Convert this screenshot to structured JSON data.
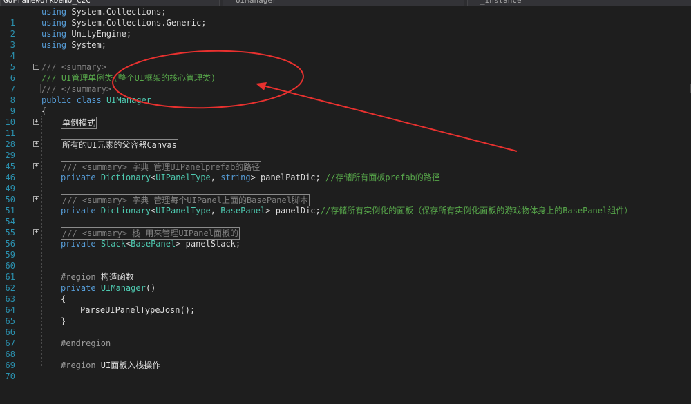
{
  "navbar": {
    "project": "GoFrameworkDemo_C2C",
    "class": "UIManager",
    "member": "_instance"
  },
  "lines": [
    {
      "n": "1",
      "fold": "",
      "code": "using System.Collections;"
    },
    {
      "n": "2",
      "fold": "",
      "code": "using System.Collections.Generic;"
    },
    {
      "n": "3",
      "fold": "",
      "code": "using UnityEngine;"
    },
    {
      "n": "4",
      "fold": "",
      "code": "using System;"
    },
    {
      "n": "5",
      "fold": "",
      "code": ""
    },
    {
      "n": "6",
      "fold": "−",
      "code": "/// <summary>"
    },
    {
      "n": "7",
      "fold": "",
      "code": "/// UI管理单例类(整个UI框架的核心管理类)"
    },
    {
      "n": "8",
      "fold": "",
      "code": "/// </summary>"
    },
    {
      "n": "9",
      "fold": "",
      "code": "public class UIManager"
    },
    {
      "n": "10",
      "fold": "",
      "code": "{"
    },
    {
      "n": "11",
      "fold": "+",
      "code": "单例模式"
    },
    {
      "n": "28",
      "fold": "",
      "code": ""
    },
    {
      "n": "29",
      "fold": "+",
      "code": "所有的UI元素的父容器Canvas"
    },
    {
      "n": "45",
      "fold": "",
      "code": ""
    },
    {
      "n": "46",
      "fold": "+",
      "code": "/// <summary> 字典 管理UIPanelprefab的路径"
    },
    {
      "n": "49",
      "fold": "",
      "code": "private Dictionary<UIPanelType, string> panelPatDic; //存储所有面板prefab的路径"
    },
    {
      "n": "50",
      "fold": "",
      "code": ""
    },
    {
      "n": "51",
      "fold": "+",
      "code": "/// <summary> 字典 管理每个UIPanel上面的BasePanel脚本"
    },
    {
      "n": "54",
      "fold": "",
      "code": "private Dictionary<UIPanelType, BasePanel> panelDic;//存储所有实例化的面板（保存所有实例化面板的游戏物体身上的BasePanel组件）"
    },
    {
      "n": "55",
      "fold": "",
      "code": ""
    },
    {
      "n": "56",
      "fold": "+",
      "code": "/// <summary> 栈 用来管理UIPanel面板的"
    },
    {
      "n": "59",
      "fold": "",
      "code": "private Stack<BasePanel> panelStack;"
    },
    {
      "n": "60",
      "fold": "",
      "code": ""
    },
    {
      "n": "61",
      "fold": "",
      "code": ""
    },
    {
      "n": "62",
      "fold": "",
      "code": "#region 构造函数"
    },
    {
      "n": "63",
      "fold": "",
      "code": "private UIManager()"
    },
    {
      "n": "64",
      "fold": "",
      "code": "{"
    },
    {
      "n": "65",
      "fold": "",
      "code": "ParseUIPanelTypeJosn();"
    },
    {
      "n": "66",
      "fold": "",
      "code": "}"
    },
    {
      "n": "67",
      "fold": "",
      "code": ""
    },
    {
      "n": "68",
      "fold": "",
      "code": "#endregion"
    },
    {
      "n": "69",
      "fold": "",
      "code": ""
    },
    {
      "n": "70",
      "fold": "",
      "code": "#region UI面板入栈操作"
    }
  ],
  "colors": {
    "background": "#1e1e1e",
    "keyword": "#569cd6",
    "type": "#4ec9b0",
    "comment": "#57a64a",
    "line_number": "#2b91af",
    "annotation": "#e8312f"
  }
}
